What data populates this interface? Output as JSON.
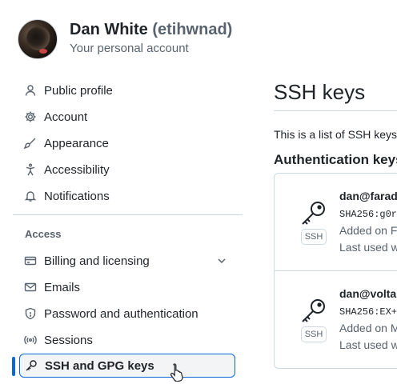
{
  "header": {
    "name": "Dan White",
    "login": "(etihwnad)",
    "subtitle": "Your personal account"
  },
  "sidebar": {
    "items": [
      {
        "label": "Public profile",
        "icon": "person-icon"
      },
      {
        "label": "Account",
        "icon": "gear-icon"
      },
      {
        "label": "Appearance",
        "icon": "paintbrush-icon"
      },
      {
        "label": "Accessibility",
        "icon": "accessibility-icon"
      },
      {
        "label": "Notifications",
        "icon": "bell-icon"
      }
    ],
    "access_heading": "Access",
    "access_items": [
      {
        "label": "Billing and licensing",
        "icon": "credit-card-icon",
        "expandable": true
      },
      {
        "label": "Emails",
        "icon": "mail-icon"
      },
      {
        "label": "Password and authentication",
        "icon": "shield-lock-icon"
      },
      {
        "label": "Sessions",
        "icon": "broadcast-icon"
      },
      {
        "label": "SSH and GPG keys",
        "icon": "key-icon",
        "active": true
      }
    ]
  },
  "main": {
    "title": "SSH keys",
    "description": "This is a list of SSH keys",
    "auth_heading": "Authentication keys",
    "keys": [
      {
        "title": "dan@faraday",
        "fingerprint": "SHA256:g0r",
        "added": "Added on F",
        "last_used": "Last used w",
        "badge": "SSH"
      },
      {
        "title": "dan@volta",
        "fingerprint": "SHA256:EX+",
        "added": "Added on M",
        "last_used": "Last used w",
        "badge": "SSH"
      }
    ]
  },
  "colors": {
    "accent": "#0969da",
    "text": "#1f2328",
    "muted": "#59636e",
    "border": "#d1d9e0"
  }
}
